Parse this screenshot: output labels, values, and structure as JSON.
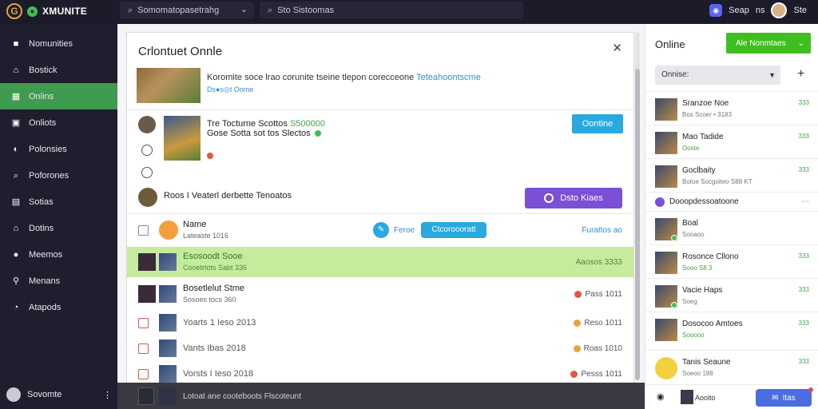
{
  "topbar": {
    "logo_letter": "G",
    "brand_name": "XMUNITE",
    "search_placeholder": "Somomatopasetrahg",
    "search2_placeholder": "Sto Sistoomas",
    "disc_label": "Seap",
    "disc_sub": "ns",
    "user_label": "Ste"
  },
  "sidebar": {
    "items": [
      {
        "label": "Nomunities",
        "icon": "square-icon"
      },
      {
        "label": "Bostick",
        "icon": "home-icon"
      },
      {
        "label": "Onlins",
        "icon": "grid-icon",
        "active": true
      },
      {
        "label": "Onliots",
        "icon": "monitor-icon"
      },
      {
        "label": "Polonsies",
        "icon": "gamepad-icon"
      },
      {
        "label": "Poforones",
        "icon": "search-icon"
      },
      {
        "label": "Sotias",
        "icon": "apps-icon"
      },
      {
        "label": "Dotins",
        "icon": "store-icon"
      },
      {
        "label": "Meemos",
        "icon": "user-icon"
      },
      {
        "label": "Menans",
        "icon": "zoom-icon"
      },
      {
        "label": "Atapods",
        "icon": "chat-icon"
      }
    ],
    "user_name": "Sovomte"
  },
  "dialog": {
    "title": "Crlontuet Onnle",
    "feature_text": "Koromite soce lrao corunite tseine tlepon corecceone",
    "feature_link": "Teteahoontscme",
    "feature_sub": "Ds●s◎t Oome",
    "invite_title": "Tre Tocturne Scottos",
    "invite_title_green": "S500000",
    "invite_title_rest": "Gose Sotta sot tos Slectos",
    "continue_label": "Oontine",
    "invite2_text": "Roos I Veaterl derbette Tenoatos",
    "purple_btn_label": "Dsto Kiaes"
  },
  "rows": [
    {
      "t1": "Name",
      "t2": "Lateaste 1016",
      "edit_label": "Feroe",
      "pill_label": "Ctcoroooratt",
      "right": "Furattos ao"
    },
    {
      "t1": "Esosoodt Sooe",
      "t2": "Cooetrtots Sabt 336",
      "right": "Aaosos 3333"
    },
    {
      "t1": "Bosetlelut Stme",
      "t2": "Sosoes tocs 360",
      "right": "Pass 1011"
    },
    {
      "t1": "Yoarts 1 Ieso 2013",
      "right": "Reso 1011"
    },
    {
      "t1": "Vants Ibas 2018",
      "right": "Roas 1010"
    },
    {
      "t1": "Vorsts I Ieso 2018",
      "right": "Pesss 1011"
    }
  ],
  "bottom_strip": {
    "text": "Lotoat ane cooteboots Flscoteunt"
  },
  "rpanel": {
    "title": "Online",
    "add_label": "Ale Nonmtaes",
    "select_label": "Onnise:",
    "items": [
      {
        "n": "Sranzoe Noe",
        "s": "Bos Scoer • 3183",
        "cnt": "333"
      },
      {
        "n": "Mao Tadide",
        "s": "Ooste",
        "s_green": true,
        "cnt": "333"
      },
      {
        "n": "Goclbaity",
        "s": "Botoe Socgoiteo S88 KT",
        "cnt": "333"
      }
    ],
    "section_label": "Dooopdessoatoone",
    "items2": [
      {
        "n": "Boal",
        "s": "Sooaoo"
      },
      {
        "n": "Rosonce Cllono",
        "s": "Sooo S8 3",
        "s_green": true,
        "cnt": "333"
      },
      {
        "n": "Vacie Haps",
        "s": "Soeg",
        "cnt": "333"
      },
      {
        "n": "Dosocoo Amtoes",
        "s": "Sooooo",
        "s_green": true,
        "s2": "Sooooo 333",
        "cnt": "333"
      },
      {
        "n": "Tanis Seaune",
        "s": "Soeoo 188",
        "cnt": "333"
      }
    ],
    "footer_label": "Aoolto",
    "chat_label": "Itas"
  }
}
